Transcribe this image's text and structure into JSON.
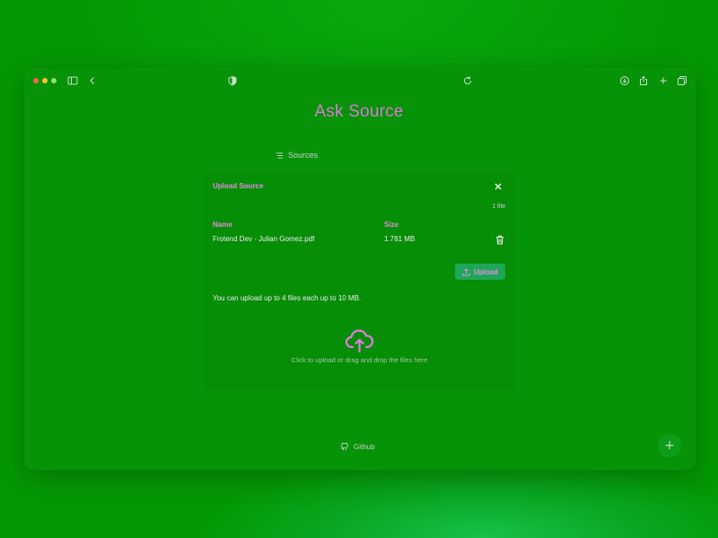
{
  "app": {
    "title": "Ask Source",
    "tab_label": "Sources"
  },
  "colors": {
    "window_bg": "#079307",
    "accent_pink": "#e58be0",
    "upload_button": "#1ea758",
    "traffic_red": "#ff5f57",
    "traffic_yellow": "#febc2e",
    "traffic_green": "#8fe07a"
  },
  "icons": {
    "browser": [
      "sidebar-icon",
      "back-icon",
      "shield-icon",
      "reload-icon",
      "download-icon",
      "share-icon",
      "new-tab-icon",
      "tabs-overview-icon"
    ],
    "panel": [
      "close-icon",
      "trash-icon",
      "upload-icon",
      "cloud-upload-icon"
    ],
    "footer": [
      "github-icon",
      "plus-icon"
    ]
  },
  "upload_panel": {
    "title": "Upload Source",
    "file_count": "1 file",
    "columns": [
      "Name",
      "Size"
    ],
    "files": [
      {
        "name": "Frotend Dev - Julian Gomez.pdf",
        "size": "1.781 MB"
      }
    ],
    "upload_label": "Upload",
    "limit_text": "You can upload up to 4 files each up to 10 MB.",
    "drop_text": "Click to upload or drag and drop the files here"
  },
  "footer": {
    "github_label": "Github",
    "fab_label": "+"
  }
}
